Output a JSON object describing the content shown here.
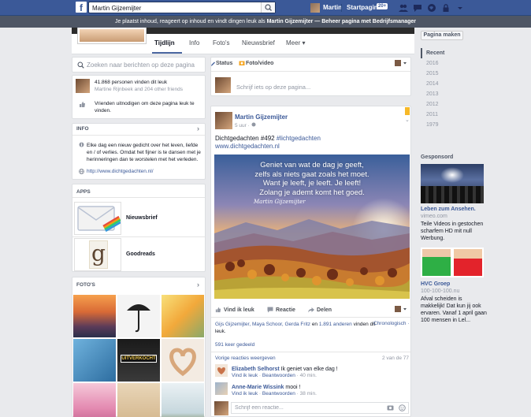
{
  "topbar": {
    "logo": "f",
    "search_value": "Martin Gijzemijter",
    "user_name": "Martin",
    "home_label": "Startpagina",
    "home_badge": "20+"
  },
  "admin_banner": {
    "text": "Je plaatst inhoud, reageert op inhoud en vindt dingen leuk als ",
    "name": "Martin Gijzemijter",
    "dash": " — ",
    "link": "Beheer pagina met Bedrijfsmanager"
  },
  "tabs": [
    {
      "label": "Tijdlijn"
    },
    {
      "label": "Info"
    },
    {
      "label": "Foto's"
    },
    {
      "label": "Nieuwsbrief"
    },
    {
      "label": "Meer ▾"
    }
  ],
  "right": {
    "make_page": "Pagina maken",
    "years": [
      "Recent",
      "2016",
      "2015",
      "2014",
      "2013",
      "2012",
      "2011",
      "1979"
    ],
    "sponsored_title": "Gesponsord",
    "ad1": {
      "title": "Leben zum Ansehen.",
      "url": "vimeo.com",
      "text": "Teile Videos in gestochen scharfem HD mit null Werbung."
    },
    "ad2": {
      "title": "HVC Groep",
      "url": "100-100-100.nu",
      "text": "Afval scheiden is makkelijk! Dat kun jij ook ervaren. Vanaf 1 april gaan 100 mensen in Lel..."
    }
  },
  "left": {
    "search_placeholder": "Zoeken naar berichten op deze pagina",
    "likes_count": "41.868 personen vinden dit leuk",
    "likes_friends": "Martine Rijnbeek and 204 other friends",
    "invite_text": "Vrienden uitnodigen om deze pagina leuk te vinden.",
    "info_title": "INFO",
    "info_text": "Elke dag een nieuw gedicht over het leven, liefde en / of verlies. Omdat het fijner is te dansen met je herinneringen dan te worstelen met het verleden.",
    "info_url": "http://www.dichtgedachten.nl/",
    "apps_title": "APPS",
    "apps": [
      {
        "label": "Nieuwsbrief"
      },
      {
        "label": "Goodreads",
        "glyph": "g"
      }
    ],
    "photos_title": "FOTO'S",
    "photo_overlay": "UITVERKOCHT"
  },
  "composer": {
    "status_label": "Status",
    "photo_label": "Foto/video",
    "placeholder": "Schrijf iets op deze pagina..."
  },
  "post": {
    "author": "Martin Gijzemijter",
    "time": "5 uur · ",
    "line1_prefix": "Dichtgedachten #492 ",
    "hashtag": "#lichtgedachten",
    "line2": "www.dichtgedachten.nl",
    "quote_lines": [
      "Geniet van wat de dag je geeft,",
      "zelfs als niets gaat zoals het moet.",
      "Want je leeft, je leeft. Je leeft!",
      "Zolang je ademt komt het goed."
    ],
    "signature": "Martin Gijzemijter",
    "actions": {
      "like": "Vind ik leuk",
      "comment": "Reactie",
      "share": "Delen"
    },
    "likers_names": "Gijs Gijzemijter, Maya Schoor, Gerda Fritz",
    "likers_and": " en ",
    "likers_others": "1.891 anderen",
    "likers_suffix": " vinden dit leuk.",
    "chrono": "Chronologisch ·",
    "shares": "591 keer gedeeld",
    "prev_comments": "Vorige reacties weergeven",
    "comment_count": "2 van de 77",
    "comments": [
      {
        "name": "Elizabeth Selhorst",
        "text": " Ik geniet van elke dag !",
        "like": "Vind ik leuk",
        "reply": "Beantwoorden",
        "time": " · 40 min."
      },
      {
        "name": "Anne-Marie Wissink",
        "text": " mooi !",
        "like": "Vind ik leuk",
        "reply": "Beantwoorden",
        "time": " · 38 min."
      }
    ],
    "reply_placeholder": "Schrijf een reactie..."
  }
}
